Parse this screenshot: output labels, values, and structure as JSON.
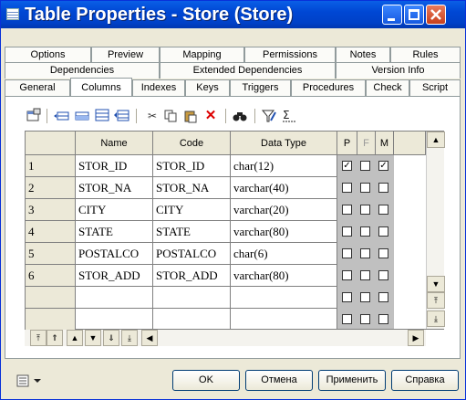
{
  "window": {
    "title": "Table Properties - Store (Store)",
    "controls": {
      "minimize": "minimize",
      "maximize": "maximize",
      "close": "close"
    }
  },
  "tabs": {
    "row1": [
      "Options",
      "Preview",
      "Mapping",
      "Permissions",
      "Notes",
      "Rules"
    ],
    "row2": [
      "Dependencies",
      "Extended Dependencies",
      "Version Info"
    ],
    "row3": [
      "General",
      "Columns",
      "Indexes",
      "Keys",
      "Triggers",
      "Procedures",
      "Check",
      "Script"
    ],
    "active": "Columns"
  },
  "toolbar": {
    "icons": [
      "properties-icon",
      "insert-row-icon",
      "add-row-icon",
      "add-rows-icon",
      "filter-rows-icon",
      "cut-icon",
      "copy-icon",
      "paste-icon",
      "delete-icon",
      "find-icon",
      "customize-filter-icon",
      "column-sum-icon"
    ]
  },
  "grid": {
    "headers": {
      "name": "Name",
      "code": "Code",
      "type": "Data Type",
      "p": "P",
      "f": "F",
      "m": "M"
    },
    "rows": [
      {
        "num": "1",
        "name": "STOR_ID",
        "code": "STOR_ID",
        "type": "char(12)",
        "p": true,
        "f": false,
        "m": true
      },
      {
        "num": "2",
        "name": "STOR_NA",
        "code": "STOR_NA",
        "type": "varchar(40)",
        "p": false,
        "f": false,
        "m": false
      },
      {
        "num": "3",
        "name": "CITY",
        "code": "CITY",
        "type": "varchar(20)",
        "p": false,
        "f": false,
        "m": false
      },
      {
        "num": "4",
        "name": "STATE",
        "code": "STATE",
        "type": "varchar(80)",
        "p": false,
        "f": false,
        "m": false
      },
      {
        "num": "5",
        "name": "POSTALCO",
        "code": "POSTALCO",
        "type": "char(6)",
        "p": false,
        "f": false,
        "m": false
      },
      {
        "num": "6",
        "name": "STOR_ADD",
        "code": "STOR_ADD",
        "type": "varchar(80)",
        "p": false,
        "f": false,
        "m": false
      },
      {
        "num": "",
        "name": "",
        "code": "",
        "type": "",
        "p": false,
        "f": false,
        "m": false
      },
      {
        "num": "",
        "name": "",
        "code": "",
        "type": "",
        "p": false,
        "f": false,
        "m": false
      }
    ]
  },
  "buttons": {
    "ok": "OK",
    "cancel": "Отмена",
    "apply": "Применить",
    "help": "Справка"
  }
}
